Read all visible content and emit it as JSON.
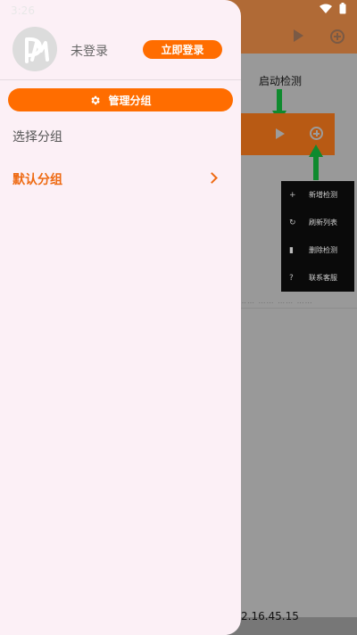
{
  "status_bar": {
    "time": "3:26"
  },
  "background": {
    "annotation_label": "启动检测",
    "menu_items": [
      {
        "icon": "plus-icon",
        "label": "新增检测"
      },
      {
        "icon": "refresh-icon",
        "label": "刷新列表"
      },
      {
        "icon": "trash-icon",
        "label": "删除检测"
      },
      {
        "icon": "help-icon",
        "label": "联系客服"
      }
    ],
    "blurred_text": "…… …… …… ……",
    "footer_text": "2.16.45.15"
  },
  "drawer": {
    "user_name": "未登录",
    "login_label": "立即登录",
    "manage_label": "管理分组",
    "section_label": "选择分组",
    "groups": [
      {
        "label": "默认分组"
      }
    ]
  },
  "colors": {
    "accent": "#ff6d00",
    "group_text": "#ee6a12",
    "drawer_bg": "#fcf0f6",
    "arrow_green": "#0f8a2e"
  }
}
